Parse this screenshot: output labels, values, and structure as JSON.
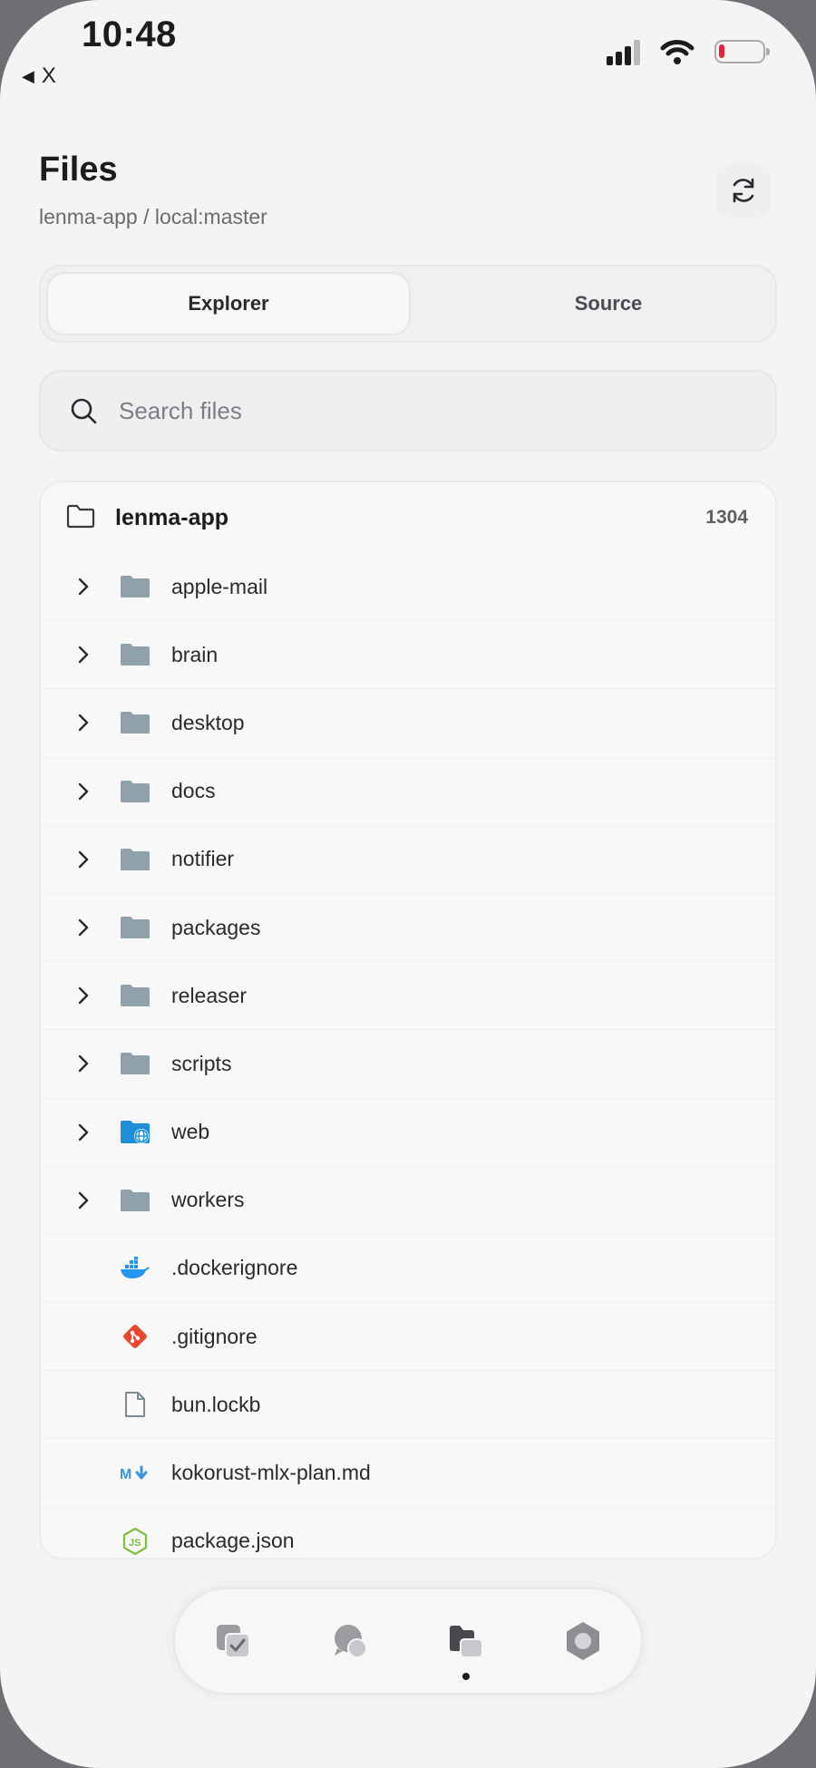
{
  "status_bar": {
    "time": "10:48",
    "back_label": "X"
  },
  "header": {
    "title": "Files",
    "breadcrumb": "lenma-app / local:master"
  },
  "tabs": [
    {
      "label": "Explorer",
      "active": true
    },
    {
      "label": "Source",
      "active": false
    }
  ],
  "search": {
    "placeholder": "Search files",
    "value": ""
  },
  "tree": {
    "root": {
      "name": "lenma-app",
      "count": "1304"
    },
    "items": [
      {
        "name": "apple-mail",
        "type": "folder",
        "icon": "folder-icon"
      },
      {
        "name": "brain",
        "type": "folder",
        "icon": "folder-icon"
      },
      {
        "name": "desktop",
        "type": "folder",
        "icon": "folder-icon"
      },
      {
        "name": "docs",
        "type": "folder",
        "icon": "folder-icon"
      },
      {
        "name": "notifier",
        "type": "folder",
        "icon": "folder-icon"
      },
      {
        "name": "packages",
        "type": "folder",
        "icon": "folder-icon"
      },
      {
        "name": "releaser",
        "type": "folder",
        "icon": "folder-icon"
      },
      {
        "name": "scripts",
        "type": "folder",
        "icon": "folder-icon"
      },
      {
        "name": "web",
        "type": "folder",
        "icon": "web-folder-icon"
      },
      {
        "name": "workers",
        "type": "folder",
        "icon": "folder-icon"
      },
      {
        "name": ".dockerignore",
        "type": "file",
        "icon": "docker-icon"
      },
      {
        "name": ".gitignore",
        "type": "file",
        "icon": "git-icon"
      },
      {
        "name": "bun.lockb",
        "type": "file",
        "icon": "file-icon"
      },
      {
        "name": "kokorust-mlx-plan.md",
        "type": "file",
        "icon": "markdown-icon"
      },
      {
        "name": "package.json",
        "type": "file",
        "icon": "nodejs-icon"
      }
    ]
  },
  "bottom_nav": [
    {
      "name": "tasks",
      "icon": "tasks-icon"
    },
    {
      "name": "chat",
      "icon": "chat-icon"
    },
    {
      "name": "files",
      "icon": "files-icon",
      "active": true
    },
    {
      "name": "settings",
      "icon": "settings-icon"
    }
  ],
  "colors": {
    "folder": "#8fa1ab",
    "web_folder": "#1c8fd6",
    "git": "#e8472b",
    "docker": "#2496ed",
    "markdown": "#3d94d8",
    "nodejs": "#7bbf3a",
    "battery_low": "#e5243b"
  }
}
